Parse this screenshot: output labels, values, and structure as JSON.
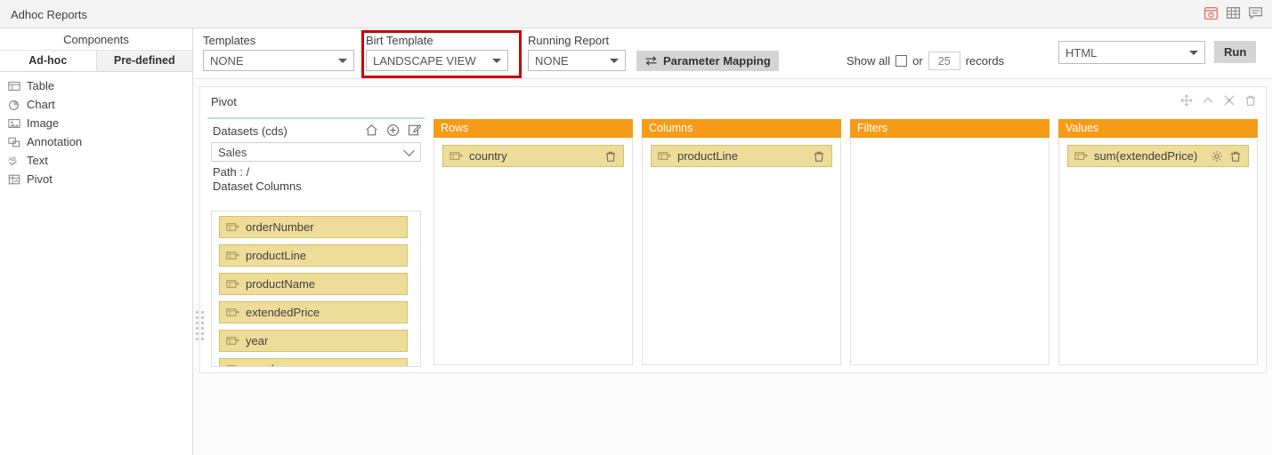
{
  "window": {
    "title": "Adhoc Reports",
    "icons": [
      {
        "name": "schedule-icon",
        "color": "#e8746b"
      },
      {
        "name": "grid-icon",
        "color": "#8a8a8a"
      },
      {
        "name": "comment-icon",
        "color": "#8a8a8a"
      }
    ]
  },
  "sidebar": {
    "header": "Components",
    "tabs": [
      {
        "label": "Ad-hoc",
        "active": true
      },
      {
        "label": "Pre-defined",
        "active": false
      }
    ],
    "items": [
      {
        "label": "Table",
        "icon": "table-icon"
      },
      {
        "label": "Chart",
        "icon": "chart-icon"
      },
      {
        "label": "Image",
        "icon": "image-icon"
      },
      {
        "label": "Annotation",
        "icon": "annotation-icon"
      },
      {
        "label": "Text",
        "icon": "text-icon"
      },
      {
        "label": "Pivot",
        "icon": "pivot-icon"
      }
    ]
  },
  "toolbar": {
    "templates": {
      "label": "Templates",
      "value": "NONE"
    },
    "birt_template": {
      "label": "Birt Template",
      "value": "LANDSCAPE VIEW",
      "highlight_color": "#cc0000"
    },
    "running_report": {
      "label": "Running Report",
      "value": "NONE"
    },
    "parameter_mapping": {
      "label": "Parameter Mapping",
      "icon": "swap-icon"
    },
    "records": {
      "show_all_label": "Show all",
      "or_label": "or",
      "count_value": "25",
      "records_label": "records",
      "checked": false
    },
    "format": {
      "value": "HTML"
    },
    "run": {
      "label": "Run"
    }
  },
  "pivot": {
    "title": "Pivot",
    "tools": [
      {
        "name": "move-icon"
      },
      {
        "name": "collapse-up-icon"
      },
      {
        "name": "settings-icon"
      },
      {
        "name": "delete-icon"
      }
    ],
    "datasets": {
      "title": "Datasets (cds)",
      "actions": [
        {
          "name": "home-icon"
        },
        {
          "name": "add-circle-icon"
        },
        {
          "name": "edit-icon"
        }
      ],
      "selected": "Sales",
      "path_label": "Path : /",
      "columns_label": "Dataset Columns",
      "columns": [
        {
          "label": "orderNumber"
        },
        {
          "label": "productLine"
        },
        {
          "label": "productName"
        },
        {
          "label": "extendedPrice"
        },
        {
          "label": "year"
        },
        {
          "label": "month"
        }
      ]
    },
    "zones": [
      {
        "title": "Rows",
        "items": [
          {
            "label": "country",
            "actions": [
              "delete-icon"
            ]
          }
        ]
      },
      {
        "title": "Columns",
        "items": [
          {
            "label": "productLine",
            "actions": [
              "delete-icon"
            ]
          }
        ]
      },
      {
        "title": "Filters",
        "items": []
      },
      {
        "title": "Values",
        "items": [
          {
            "label": "sum(extendedPrice)",
            "actions": [
              "settings-icon",
              "delete-icon"
            ]
          }
        ]
      }
    ]
  },
  "colors": {
    "zone_header": "#f59b18",
    "chip_bg": "#eedd99",
    "chip_border": "#d6c06a",
    "accent_top": "#b8e2e4"
  }
}
